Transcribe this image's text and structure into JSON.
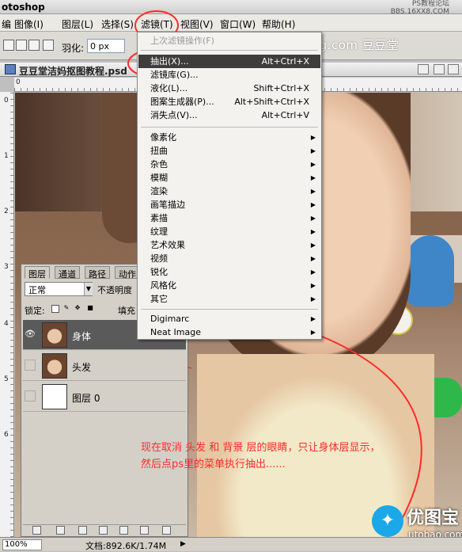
{
  "app": {
    "title": "otoshop",
    "forum_label": "PS教程论坛",
    "forum_sub": "BBS.16XX8.COM"
  },
  "menubar": {
    "items": [
      "编",
      "图像(I)",
      "图层(L)",
      "选择(S)",
      "滤镜(T)",
      "视图(V)",
      "窗口(W)",
      "帮助(H)"
    ]
  },
  "options": {
    "feather_label": "羽化:",
    "feather_value": "0 px",
    "watermark": "www.dodotang.com 豆豆堂"
  },
  "document": {
    "title": "豆豆堂洁妈抠图教程.psd",
    "ruler_top": [
      "0"
    ],
    "ruler_left": [
      "0",
      "1",
      "2",
      "3",
      "4",
      "5",
      "6"
    ]
  },
  "filter_menu": {
    "last_filter": "上次滤镜操作(F)",
    "last_filter_shortcut": "Ctrl+F",
    "items": [
      {
        "label": "抽出(X)...",
        "shortcut": "Alt+Ctrl+X"
      },
      {
        "label": "滤镜库(G)...",
        "shortcut": ""
      },
      {
        "label": "液化(L)...",
        "shortcut": "Shift+Ctrl+X"
      },
      {
        "label": "图案生成器(P)...",
        "shortcut": "Alt+Shift+Ctrl+X"
      },
      {
        "label": "消失点(V)...",
        "shortcut": "Alt+Ctrl+V"
      }
    ],
    "submenus": [
      "像素化",
      "扭曲",
      "杂色",
      "模糊",
      "渲染",
      "画笔描边",
      "素描",
      "纹理",
      "艺术效果",
      "视频",
      "锐化",
      "风格化",
      "其它"
    ],
    "plugins": [
      "Digimarc",
      "Neat Image"
    ]
  },
  "layers_panel": {
    "tabs": [
      "图层",
      "通道",
      "路径",
      "动作"
    ],
    "blend_mode": "正常",
    "opacity_label": "不透明度",
    "lock_label": "锁定:",
    "fill_label": "填充",
    "layers": [
      {
        "name": "身体",
        "visible": true,
        "selected": true
      },
      {
        "name": "头发",
        "visible": false,
        "selected": false
      },
      {
        "name": "图层 0",
        "visible": false,
        "selected": false
      }
    ]
  },
  "annotation": {
    "line1": "现在取消 头发 和 背景 层的眼睛，只让身体层显示，",
    "line2": "然后点ps里的菜单执行抽出......"
  },
  "statusbar": {
    "zoom": "100%",
    "doc_info": "文档:892.6K/1.74M"
  },
  "logo": {
    "text": "优图宝",
    "url": "utobao.com"
  },
  "colors": {
    "annotation_red": "#ff2a2a",
    "menu_highlight": "#3d3d3d",
    "logo_blue": "#1ba7e8"
  }
}
